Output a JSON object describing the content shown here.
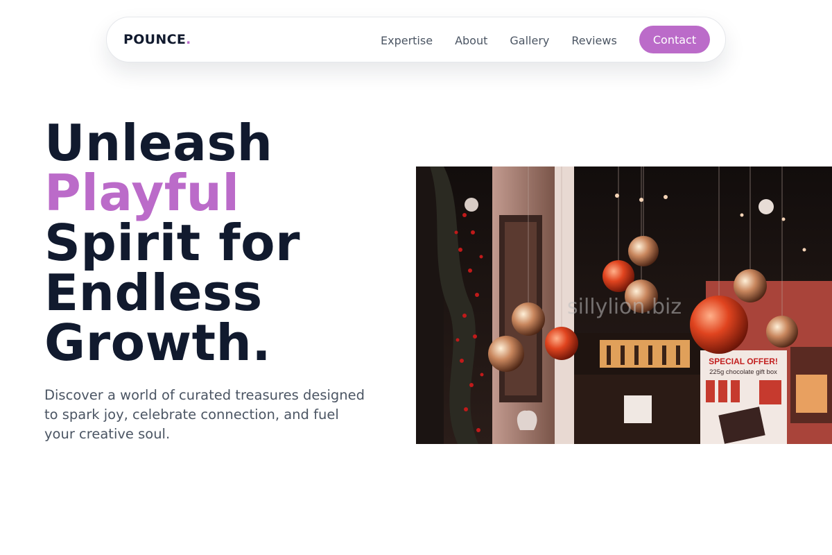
{
  "nav": {
    "logo_text": "POUNCE",
    "logo_dot": ".",
    "links": [
      "Expertise",
      "About",
      "Gallery",
      "Reviews"
    ],
    "contact_label": "Contact"
  },
  "hero": {
    "headline_line1": "Unleash",
    "headline_accent": "Playful",
    "headline_line3": "Spirit for",
    "headline_line4": "Endless",
    "headline_line5": "Growth.",
    "subtitle": "Discover a world of curated treasures designed to spark joy, celebrate connection, and fuel your creative soul.",
    "image": {
      "watermark": "sillylion.biz",
      "sign_title": "SPECIAL OFFER!",
      "sign_subtitle": "225g chocolate gift box"
    }
  },
  "colors": {
    "accent": "#bb6bc9",
    "heading": "#111a2e",
    "body_text": "#4b5563"
  }
}
